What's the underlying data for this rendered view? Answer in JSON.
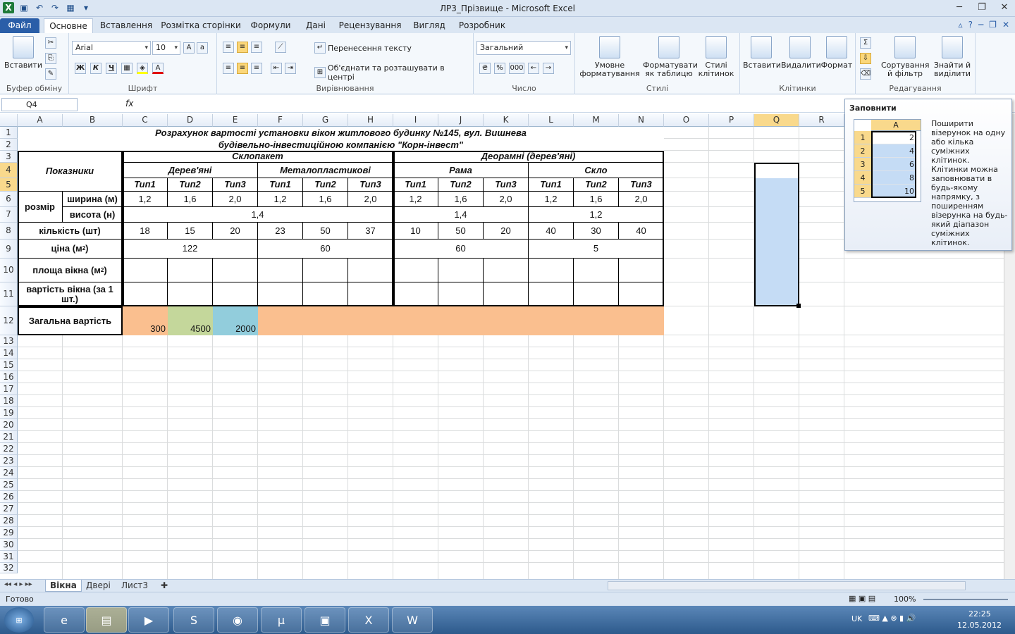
{
  "window": {
    "title": "ЛР3_Прізвище - Microsoft Excel"
  },
  "tabs": [
    "Файл",
    "Основне",
    "Вставлення",
    "Розмітка сторінки",
    "Формули",
    "Дані",
    "Рецензування",
    "Вигляд",
    "Розробник"
  ],
  "ribbon": {
    "paste": "Вставити",
    "clipboard": "Буфер обміну",
    "font_group": "Шрифт",
    "font_name": "Arial",
    "font_size": "10",
    "bold": "Ж",
    "italic": "К",
    "underline": "Ч",
    "align_group": "Вирівнювання",
    "wrap": "Перенесення тексту",
    "merge": "Об'єднати та розташувати в центрі",
    "number_group": "Число",
    "number_format": "Загальний",
    "percent": "%",
    "thousands": "000",
    "cond_format": "Умовне форматування",
    "format_table": "Форматувати як таблицю",
    "cell_styles": "Стилі клітинок",
    "styles_group": "Стилі",
    "insert": "Вставити",
    "delete": "Видалити",
    "format": "Формат",
    "cells_group": "Клітинки",
    "sort": "Сортування й фільтр",
    "find": "Знайти й виділити",
    "edit_group": "Редагування",
    "autosum": "Σ"
  },
  "formula_bar": {
    "name_box": "Q4",
    "fx": "fx",
    "value": ""
  },
  "columns": [
    "A",
    "B",
    "C",
    "D",
    "E",
    "F",
    "G",
    "H",
    "I",
    "J",
    "K",
    "L",
    "M",
    "N",
    "O",
    "P",
    "Q",
    "R"
  ],
  "rows": [
    "1",
    "2",
    "3",
    "4",
    "5",
    "6",
    "7",
    "8",
    "9",
    "10",
    "11",
    "12",
    "13",
    "14",
    "15",
    "16",
    "17",
    "18",
    "19",
    "20",
    "21",
    "22",
    "23",
    "24",
    "25",
    "26",
    "27",
    "28",
    "29",
    "30",
    "31",
    "32"
  ],
  "table": {
    "title1": "Розрахунок вартості установки вікон житлового будинку №145, вул. Вишнева",
    "title2": "будівельно-інвестиційною компанією \"Корн-інвест\"",
    "indicators": "Показники",
    "glass": "Склопакет",
    "frame_group": "Деорамні (дерев'яні)",
    "wood": "Дерев'яні",
    "metal": "Металопластикові",
    "frame": "Рама",
    "pane": "Скло",
    "types": [
      "Тип1",
      "Тип2",
      "Тип3",
      "Тип1",
      "Тип2",
      "Тип3",
      "Тип1",
      "Тип2",
      "Тип3",
      "Тип1",
      "Тип2",
      "Тип3"
    ],
    "size": "розмір",
    "width": "ширина (м)",
    "height": "висота (н)",
    "widths": [
      "1,2",
      "1,6",
      "2,0",
      "1,2",
      "1,6",
      "2,0",
      "1,2",
      "1,6",
      "2,0",
      "1,2",
      "1,6",
      "2,0"
    ],
    "height_glass": "1,4",
    "height_frame": "1,4",
    "height_pane": "1,2",
    "qty": "кількість (шт)",
    "qtys": [
      "18",
      "15",
      "20",
      "23",
      "50",
      "37",
      "10",
      "50",
      "20",
      "40",
      "30",
      "40"
    ],
    "price": "ціна (м",
    "price_sup": "2",
    "price_close": ")",
    "prices": [
      "122",
      "60",
      "60",
      "5"
    ],
    "area": "площа вікна (м",
    "area_sup": "2",
    "area_close": ")",
    "cost": "вартість вікна (за 1 шт.)",
    "total": "Загальна вартість",
    "totals": [
      "300",
      "4500",
      "2000"
    ]
  },
  "sheets": [
    "Вікна",
    "Двері",
    "Лист3"
  ],
  "status": {
    "ready": "Готово",
    "zoom": "100%"
  },
  "tooltip": {
    "title": "Заповнити",
    "col": "A",
    "rows": [
      "1",
      "2",
      "3",
      "4",
      "5"
    ],
    "vals": [
      "2",
      "4",
      "6",
      "8",
      "10"
    ],
    "text1": "Поширити візерунок на одну або кілька суміжних клітинок.",
    "text2": "Клітинки можна заповнювати в будь-якому напрямку, з поширенням візерунка на будь-який діапазон суміжних клітинок."
  },
  "taskbar": {
    "lang": "UK",
    "time": "22:25",
    "date": "12.05.2012"
  }
}
